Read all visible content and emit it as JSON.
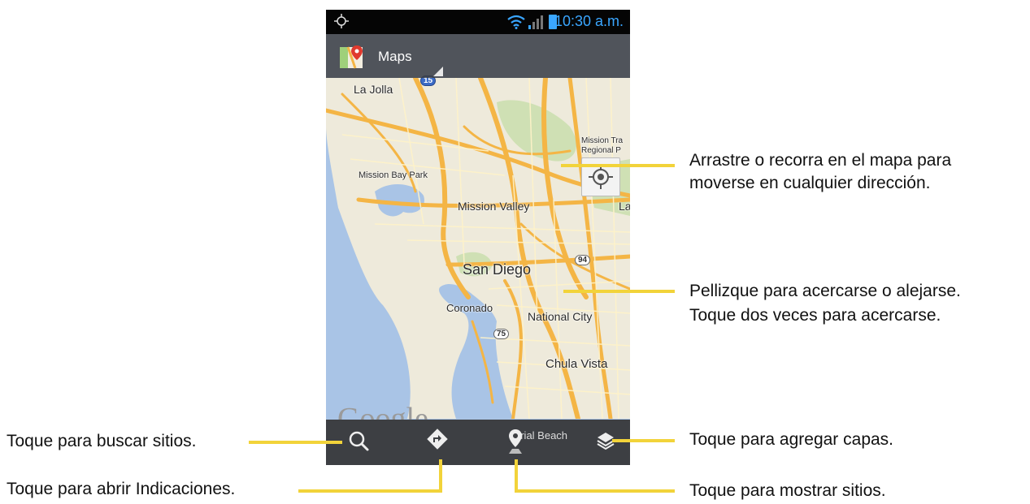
{
  "status_bar": {
    "time": "10:30 a.m."
  },
  "app_bar": {
    "title": "Maps"
  },
  "map": {
    "labels": {
      "la_jolla": "La Jolla",
      "mission_trails": "Mission Tra",
      "regional_park": "Regional P",
      "mission_bay_park": "Mission Bay Park",
      "mission_valley": "Mission Valley",
      "la": "La",
      "san_diego": "San Diego",
      "coronado": "Coronado",
      "national_city": "National City",
      "chula_vista": "Chula Vista",
      "imperial_beach": "erial Beach",
      "hwy_94": "94",
      "hwy_75": "75",
      "hwy_15": "15"
    },
    "watermark": "Google"
  },
  "callouts": {
    "drag": [
      "Arrastre o recorra en el mapa para",
      "moverse en cualquier dirección."
    ],
    "pinch": [
      "Pellizque para acercarse o alejarse.",
      "Toque dos veces para acercarse."
    ],
    "search": "Toque para buscar sitios.",
    "directions": "Toque para abrir Indicaciones.",
    "layers": "Toque para agregar capas.",
    "places": "Toque para mostrar sitios."
  },
  "colors": {
    "callout_line": "#f2d33a",
    "status_accent": "#3aa6ff",
    "water": "#a9c4e6",
    "land": "#eeeadb",
    "road": "#f4b545"
  },
  "icons": {
    "status": [
      "gps-icon",
      "wifi-icon",
      "signal-icon",
      "battery-icon"
    ],
    "app": "maps-logo-icon",
    "toolbar": [
      "search-icon",
      "directions-icon",
      "places-icon",
      "layers-icon"
    ],
    "map": "my-location-icon"
  }
}
